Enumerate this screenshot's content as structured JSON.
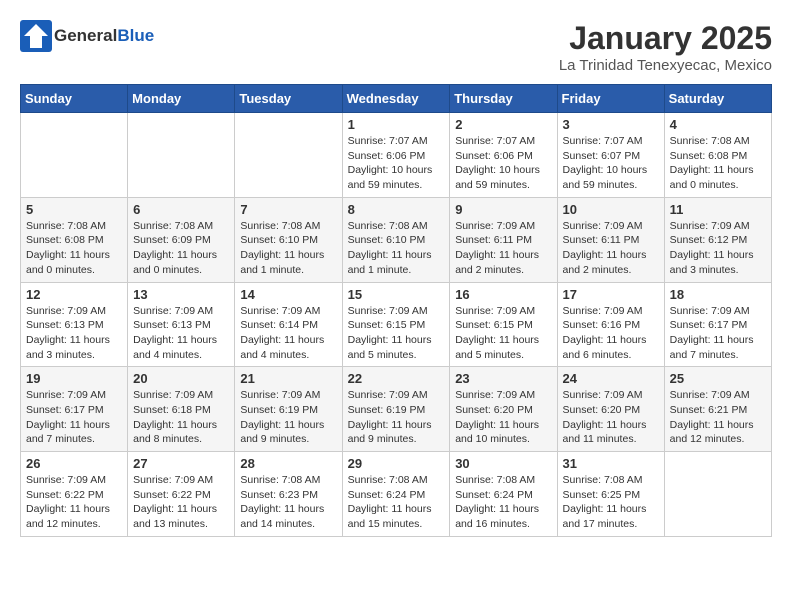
{
  "logo": {
    "general": "General",
    "blue": "Blue",
    "tagline": "GeneralBlue"
  },
  "header": {
    "month": "January 2025",
    "location": "La Trinidad Tenexyecac, Mexico"
  },
  "weekdays": [
    "Sunday",
    "Monday",
    "Tuesday",
    "Wednesday",
    "Thursday",
    "Friday",
    "Saturday"
  ],
  "weeks": [
    [
      {
        "day": "",
        "info": ""
      },
      {
        "day": "",
        "info": ""
      },
      {
        "day": "",
        "info": ""
      },
      {
        "day": "1",
        "info": "Sunrise: 7:07 AM\nSunset: 6:06 PM\nDaylight: 10 hours and 59 minutes."
      },
      {
        "day": "2",
        "info": "Sunrise: 7:07 AM\nSunset: 6:06 PM\nDaylight: 10 hours and 59 minutes."
      },
      {
        "day": "3",
        "info": "Sunrise: 7:07 AM\nSunset: 6:07 PM\nDaylight: 10 hours and 59 minutes."
      },
      {
        "day": "4",
        "info": "Sunrise: 7:08 AM\nSunset: 6:08 PM\nDaylight: 11 hours and 0 minutes."
      }
    ],
    [
      {
        "day": "5",
        "info": "Sunrise: 7:08 AM\nSunset: 6:08 PM\nDaylight: 11 hours and 0 minutes."
      },
      {
        "day": "6",
        "info": "Sunrise: 7:08 AM\nSunset: 6:09 PM\nDaylight: 11 hours and 0 minutes."
      },
      {
        "day": "7",
        "info": "Sunrise: 7:08 AM\nSunset: 6:10 PM\nDaylight: 11 hours and 1 minute."
      },
      {
        "day": "8",
        "info": "Sunrise: 7:08 AM\nSunset: 6:10 PM\nDaylight: 11 hours and 1 minute."
      },
      {
        "day": "9",
        "info": "Sunrise: 7:09 AM\nSunset: 6:11 PM\nDaylight: 11 hours and 2 minutes."
      },
      {
        "day": "10",
        "info": "Sunrise: 7:09 AM\nSunset: 6:11 PM\nDaylight: 11 hours and 2 minutes."
      },
      {
        "day": "11",
        "info": "Sunrise: 7:09 AM\nSunset: 6:12 PM\nDaylight: 11 hours and 3 minutes."
      }
    ],
    [
      {
        "day": "12",
        "info": "Sunrise: 7:09 AM\nSunset: 6:13 PM\nDaylight: 11 hours and 3 minutes."
      },
      {
        "day": "13",
        "info": "Sunrise: 7:09 AM\nSunset: 6:13 PM\nDaylight: 11 hours and 4 minutes."
      },
      {
        "day": "14",
        "info": "Sunrise: 7:09 AM\nSunset: 6:14 PM\nDaylight: 11 hours and 4 minutes."
      },
      {
        "day": "15",
        "info": "Sunrise: 7:09 AM\nSunset: 6:15 PM\nDaylight: 11 hours and 5 minutes."
      },
      {
        "day": "16",
        "info": "Sunrise: 7:09 AM\nSunset: 6:15 PM\nDaylight: 11 hours and 5 minutes."
      },
      {
        "day": "17",
        "info": "Sunrise: 7:09 AM\nSunset: 6:16 PM\nDaylight: 11 hours and 6 minutes."
      },
      {
        "day": "18",
        "info": "Sunrise: 7:09 AM\nSunset: 6:17 PM\nDaylight: 11 hours and 7 minutes."
      }
    ],
    [
      {
        "day": "19",
        "info": "Sunrise: 7:09 AM\nSunset: 6:17 PM\nDaylight: 11 hours and 7 minutes."
      },
      {
        "day": "20",
        "info": "Sunrise: 7:09 AM\nSunset: 6:18 PM\nDaylight: 11 hours and 8 minutes."
      },
      {
        "day": "21",
        "info": "Sunrise: 7:09 AM\nSunset: 6:19 PM\nDaylight: 11 hours and 9 minutes."
      },
      {
        "day": "22",
        "info": "Sunrise: 7:09 AM\nSunset: 6:19 PM\nDaylight: 11 hours and 9 minutes."
      },
      {
        "day": "23",
        "info": "Sunrise: 7:09 AM\nSunset: 6:20 PM\nDaylight: 11 hours and 10 minutes."
      },
      {
        "day": "24",
        "info": "Sunrise: 7:09 AM\nSunset: 6:20 PM\nDaylight: 11 hours and 11 minutes."
      },
      {
        "day": "25",
        "info": "Sunrise: 7:09 AM\nSunset: 6:21 PM\nDaylight: 11 hours and 12 minutes."
      }
    ],
    [
      {
        "day": "26",
        "info": "Sunrise: 7:09 AM\nSunset: 6:22 PM\nDaylight: 11 hours and 12 minutes."
      },
      {
        "day": "27",
        "info": "Sunrise: 7:09 AM\nSunset: 6:22 PM\nDaylight: 11 hours and 13 minutes."
      },
      {
        "day": "28",
        "info": "Sunrise: 7:08 AM\nSunset: 6:23 PM\nDaylight: 11 hours and 14 minutes."
      },
      {
        "day": "29",
        "info": "Sunrise: 7:08 AM\nSunset: 6:24 PM\nDaylight: 11 hours and 15 minutes."
      },
      {
        "day": "30",
        "info": "Sunrise: 7:08 AM\nSunset: 6:24 PM\nDaylight: 11 hours and 16 minutes."
      },
      {
        "day": "31",
        "info": "Sunrise: 7:08 AM\nSunset: 6:25 PM\nDaylight: 11 hours and 17 minutes."
      },
      {
        "day": "",
        "info": ""
      }
    ]
  ]
}
